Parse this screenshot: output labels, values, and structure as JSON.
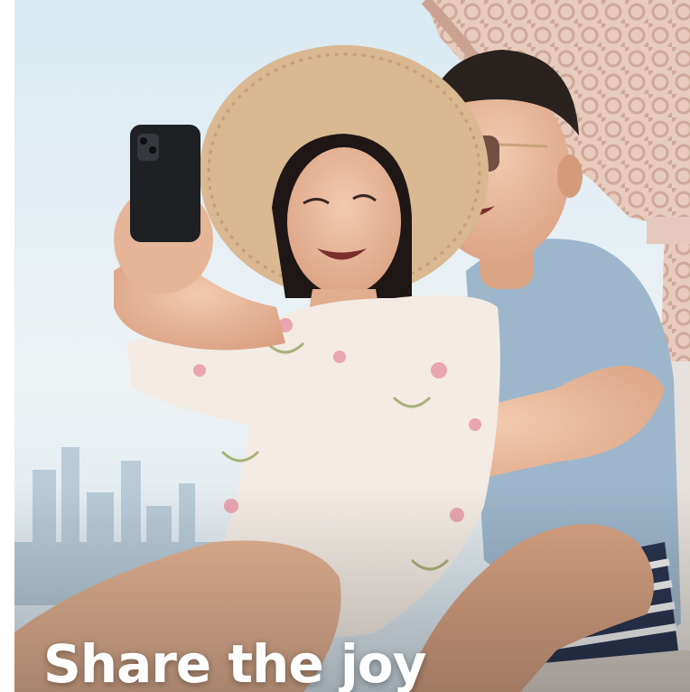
{
  "banner": {
    "headline": "Share the joy"
  },
  "colors": {
    "headline_text": "#ffffff",
    "sky_top": "#dbeaf3",
    "sky_bottom": "#f4f7f8",
    "wicker": "#d8b7a8",
    "shirt_blue": "#9fb7cc",
    "hat_straw": "#d9b892",
    "blouse": "#f3ebe4"
  }
}
